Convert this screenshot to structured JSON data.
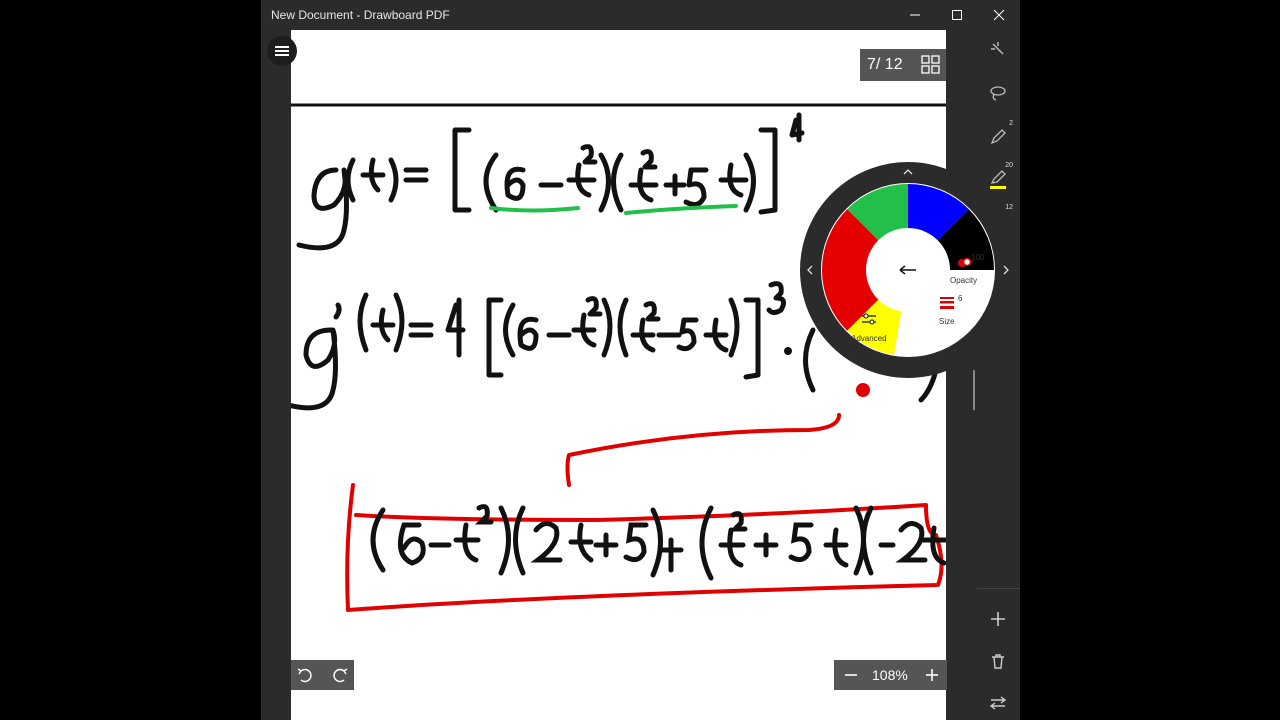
{
  "window": {
    "title": "New Document - Drawboard PDF"
  },
  "page_indicator": {
    "text": "7/ 12"
  },
  "zoom": {
    "value": "108%"
  },
  "right_toolbar": {
    "pen_size": "2",
    "highlighter_size": "20",
    "third_size": "12"
  },
  "radial_menu": {
    "opacity_label": "Opacity",
    "opacity_value": "100",
    "size_label": "Size",
    "size_value": "6",
    "advanced_label": "Advanced",
    "colors": [
      "#000000",
      "#0000ff",
      "#22c04a",
      "#e40000",
      "#ffff00",
      "#ffffff"
    ]
  },
  "colors": {
    "accent_red": "#e00000",
    "accent_green": "#22c04a"
  }
}
